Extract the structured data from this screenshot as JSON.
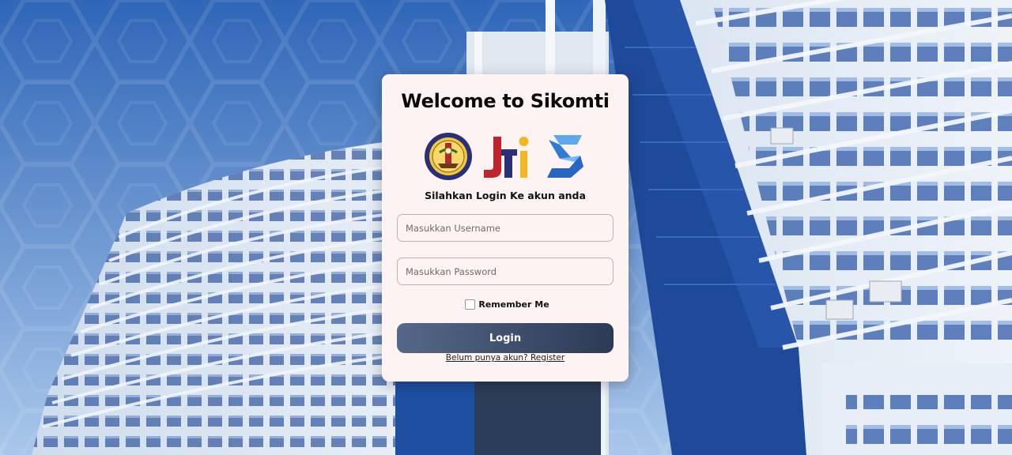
{
  "login": {
    "title": "Welcome to Sikomti",
    "subtitle": "Silahkan Login Ke akun anda",
    "username_placeholder": "Masukkan Username",
    "password_placeholder": "Masukkan Password",
    "remember_label": "Remember Me",
    "remember_checked": false,
    "login_button": "Login",
    "register_link": "Belum punya akun? Register"
  },
  "logos": [
    {
      "name": "polines-seal-logo"
    },
    {
      "name": "jti-logo"
    },
    {
      "name": "sikomti-s-logo"
    }
  ],
  "colors": {
    "card_bg": "#fdf3f2",
    "button_start": "#56688a",
    "button_end": "#2c3a55",
    "building_blue": "#1f4a9a",
    "background_blue": "#3a73c4"
  }
}
